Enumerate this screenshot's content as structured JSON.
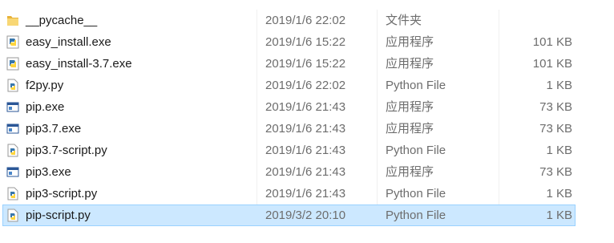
{
  "files": [
    {
      "name": "__pycache__",
      "date": "2019/1/6 22:02",
      "type": "文件夹",
      "size": "",
      "icon": "folder-icon",
      "selected": false
    },
    {
      "name": "easy_install.exe",
      "date": "2019/1/6 15:22",
      "type": "应用程序",
      "size": "101 KB",
      "icon": "python-exe-icon",
      "selected": false
    },
    {
      "name": "easy_install-3.7.exe",
      "date": "2019/1/6 15:22",
      "type": "应用程序",
      "size": "101 KB",
      "icon": "python-exe-icon",
      "selected": false
    },
    {
      "name": "f2py.py",
      "date": "2019/1/6 22:02",
      "type": "Python File",
      "size": "1 KB",
      "icon": "python-file-icon",
      "selected": false
    },
    {
      "name": "pip.exe",
      "date": "2019/1/6 21:43",
      "type": "应用程序",
      "size": "73 KB",
      "icon": "app-window-icon",
      "selected": false
    },
    {
      "name": "pip3.7.exe",
      "date": "2019/1/6 21:43",
      "type": "应用程序",
      "size": "73 KB",
      "icon": "app-window-icon",
      "selected": false
    },
    {
      "name": "pip3.7-script.py",
      "date": "2019/1/6 21:43",
      "type": "Python File",
      "size": "1 KB",
      "icon": "python-file-icon",
      "selected": false
    },
    {
      "name": "pip3.exe",
      "date": "2019/1/6 21:43",
      "type": "应用程序",
      "size": "73 KB",
      "icon": "app-window-icon",
      "selected": false
    },
    {
      "name": "pip3-script.py",
      "date": "2019/1/6 21:43",
      "type": "Python File",
      "size": "1 KB",
      "icon": "python-file-icon",
      "selected": false
    },
    {
      "name": "pip-script.py",
      "date": "2019/3/2 20:10",
      "type": "Python File",
      "size": "1 KB",
      "icon": "python-file-icon",
      "selected": true
    }
  ],
  "colors": {
    "selection_bg": "#cce8ff",
    "selection_border": "#99d1ff",
    "folder_yellow": "#f4c94f",
    "python_blue": "#3776ab",
    "python_yellow": "#ffd43b",
    "secondary_text": "#6d6d6d"
  }
}
